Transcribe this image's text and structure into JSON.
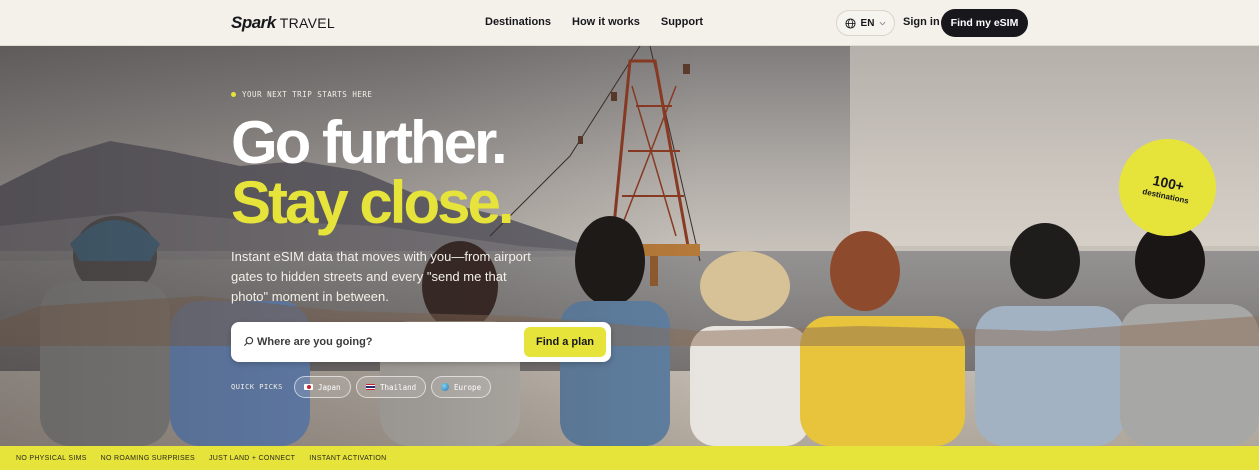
{
  "header": {
    "logo_mark": "Spark",
    "logo_sub": "TRAVEL",
    "nav": [
      "Destinations",
      "How it works",
      "Support"
    ],
    "lang": "EN",
    "signin": "Sign in",
    "cta": "Find my eSIM"
  },
  "hero": {
    "eyebrow": "YOUR NEXT TRIP STARTS HERE",
    "title_line1": "Go further.",
    "title_line2": "Stay close.",
    "lead": "Instant eSIM data that moves with you—from airport gates to hidden streets and every \"send me that photo\" moment in between.",
    "search_placeholder": "Where are you going?",
    "search_button": "Find a plan",
    "quick_label": "QUICK PICKS",
    "quick_picks": [
      {
        "label": "Japan",
        "icon": "japan-flag-icon"
      },
      {
        "label": "Thailand",
        "icon": "thailand-flag-icon"
      },
      {
        "label": "Europe",
        "icon": "globe-icon"
      }
    ],
    "badge_number": "100+",
    "badge_label": "destinations"
  },
  "ticker": [
    "NO PHYSICAL SIMS",
    "NO ROAMING SURPRISES",
    "JUST LAND + CONNECT",
    "INSTANT ACTIVATION"
  ],
  "colors": {
    "accent": "#e6e33a",
    "dark": "#17171c",
    "header_bg": "#f3f1ea"
  }
}
